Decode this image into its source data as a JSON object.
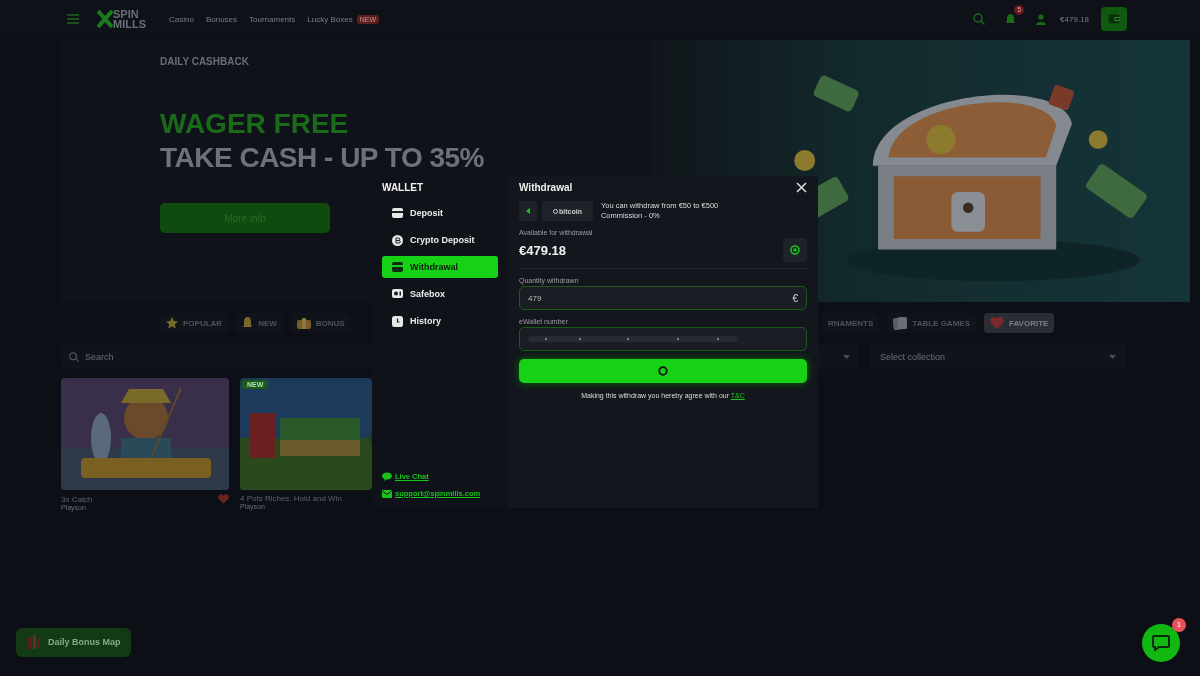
{
  "header": {
    "logo": "SPIN MILLS",
    "nav": [
      {
        "label": "Casino"
      },
      {
        "label": "Bonuses"
      },
      {
        "label": "Tournaments"
      },
      {
        "label": "Lucky Boxes",
        "badge": "NEW"
      }
    ],
    "notifications_badge": "5",
    "balance": "€479.18"
  },
  "hero": {
    "eyebrow": "DAILY CASHBACK",
    "headline_1": "WAGER FREE",
    "headline_2": "TAKE CASH - UP TO 35%",
    "button": "More info"
  },
  "categories_left": [
    {
      "label": "POPULAR",
      "kind": "star",
      "selected": false
    },
    {
      "label": "NEW",
      "kind": "bell",
      "selected": false
    },
    {
      "label": "BONUS",
      "kind": "gift",
      "selected": false
    }
  ],
  "categories_right": [
    {
      "label": "RNAMENTS",
      "kind": "none",
      "selected": false
    },
    {
      "label": "TABLE GAMES",
      "kind": "cards",
      "selected": false
    },
    {
      "label": "FAVORITE",
      "kind": "heart",
      "selected": true
    }
  ],
  "filters": {
    "search_placeholder": "Search",
    "collection_placeholder": "Select collection"
  },
  "games": [
    {
      "title": "3x Catch",
      "provider": "Playson",
      "favorite": true
    },
    {
      "title": "4 Pots Riches: Hold and Win",
      "provider": "Playson",
      "badge": "NEW",
      "favorite": false
    }
  ],
  "bonus_map": {
    "label": "Daily Bonus Map"
  },
  "chat": {
    "badge": "1"
  },
  "wallet": {
    "title": "WALLET",
    "menu": [
      {
        "label": "Deposit",
        "kind": "card",
        "selected": false
      },
      {
        "label": "Crypto Deposit",
        "kind": "coin",
        "selected": false
      },
      {
        "label": "Withdrawal",
        "kind": "card",
        "selected": true
      },
      {
        "label": "Safebox",
        "kind": "safe",
        "selected": false
      },
      {
        "label": "History",
        "kind": "clock",
        "selected": false
      }
    ],
    "live_chat": "Live Chat",
    "email": "support@spinmills.com"
  },
  "withdrawal": {
    "title": "Withdrawal",
    "method": "bitcoin",
    "limits": "You can withdraw from €50 to €500",
    "commission": "Commission - 0%",
    "available_label": "Available for withdrawal",
    "available": "€479.18",
    "quantity_label": "Quantity withdrawn",
    "quantity": "479",
    "currency": "€",
    "ewallet_label": "eWallet number",
    "loading": true,
    "agreement": "Making this withdraw you hereby agree with our",
    "terms_link": "T&C"
  }
}
